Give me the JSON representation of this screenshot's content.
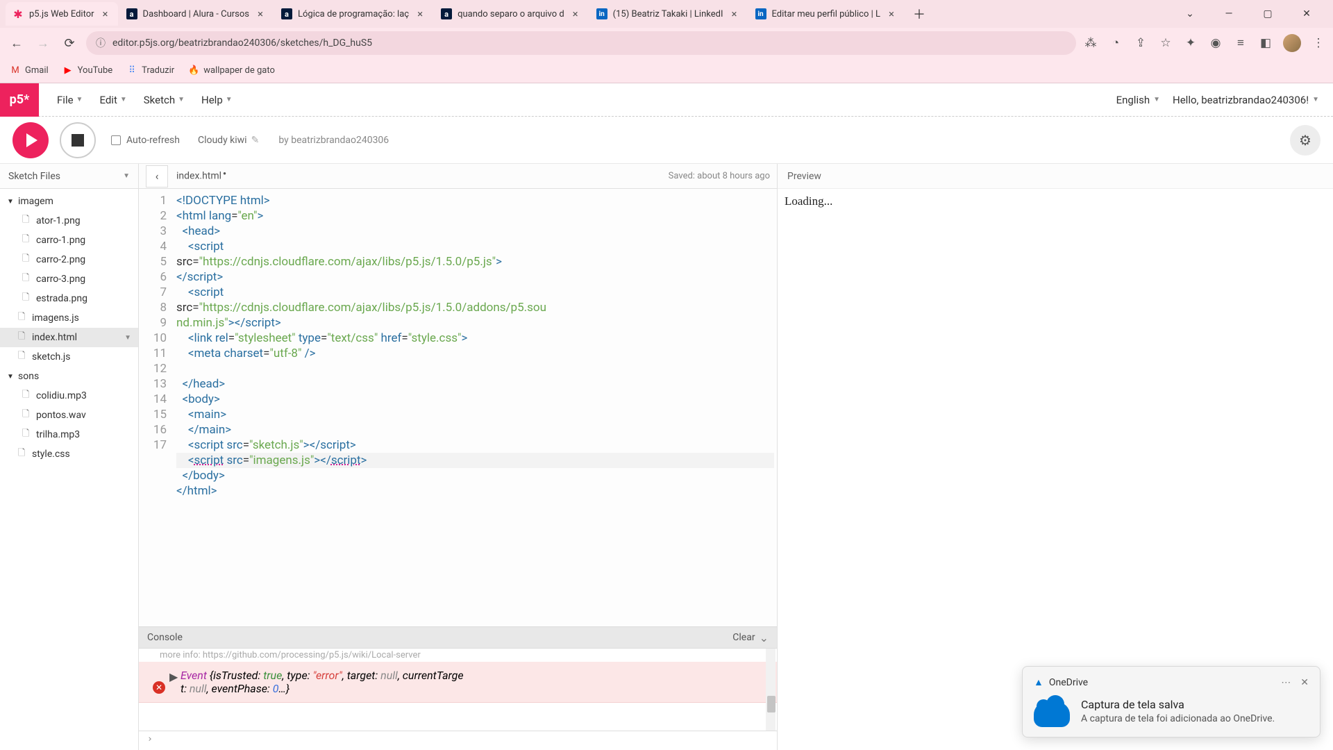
{
  "browser": {
    "tabs": [
      {
        "title": "p5.js Web Editor",
        "active": true,
        "icon": "p5"
      },
      {
        "title": "Dashboard | Alura - Cursos",
        "active": false,
        "icon": "alura"
      },
      {
        "title": "Lógica de programação: laç",
        "active": false,
        "icon": "alura"
      },
      {
        "title": "quando separo o arquivo d",
        "active": false,
        "icon": "alura"
      },
      {
        "title": "(15) Beatriz Takaki | LinkedI",
        "active": false,
        "icon": "linkedin"
      },
      {
        "title": "Editar meu perfil público | L",
        "active": false,
        "icon": "linkedin"
      }
    ],
    "url": "editor.p5js.org/beatrizbrandao240306/sketches/h_DG_huS5",
    "bookmarks": [
      {
        "label": "Gmail",
        "icon": "M",
        "color": "#d93025"
      },
      {
        "label": "YouTube",
        "icon": "▶",
        "color": "#ff0000"
      },
      {
        "label": "Traduzir",
        "icon": "⠿",
        "color": "#4285f4"
      },
      {
        "label": "wallpaper de gato",
        "icon": "🔥",
        "color": "#f57c00"
      }
    ]
  },
  "menubar": {
    "logo": "p5*",
    "items": [
      "File",
      "Edit",
      "Sketch",
      "Help"
    ],
    "language": "English",
    "hello": "Hello, beatrizbrandao240306!"
  },
  "toolbar": {
    "auto_refresh": "Auto-refresh",
    "sketch_name": "Cloudy kiwi",
    "byline": "by beatrizbrandao240306"
  },
  "sidebar": {
    "header": "Sketch Files",
    "tree": [
      {
        "name": "imagem",
        "type": "folder",
        "open": true
      },
      {
        "name": "ator-1.png",
        "type": "file",
        "nested": true
      },
      {
        "name": "carro-1.png",
        "type": "file",
        "nested": true
      },
      {
        "name": "carro-2.png",
        "type": "file",
        "nested": true
      },
      {
        "name": "carro-3.png",
        "type": "file",
        "nested": true
      },
      {
        "name": "estrada.png",
        "type": "file",
        "nested": true
      },
      {
        "name": "imagens.js",
        "type": "file"
      },
      {
        "name": "index.html",
        "type": "file",
        "selected": true
      },
      {
        "name": "sketch.js",
        "type": "file"
      },
      {
        "name": "sons",
        "type": "folder",
        "open": true
      },
      {
        "name": "colidiu.mp3",
        "type": "file",
        "nested": true
      },
      {
        "name": "pontos.wav",
        "type": "file",
        "nested": true
      },
      {
        "name": "trilha.mp3",
        "type": "file",
        "nested": true
      },
      {
        "name": "style.css",
        "type": "file"
      }
    ]
  },
  "editor": {
    "current_file": "index.html",
    "unsaved": true,
    "saved_text": "Saved: about 8 hours ago",
    "lines": [
      [
        {
          "t": "tag",
          "v": "<!DOCTYPE html>"
        }
      ],
      [
        {
          "t": "tag",
          "v": "<html "
        },
        {
          "t": "attr",
          "v": "lang"
        },
        {
          "t": "punc",
          "v": "="
        },
        {
          "t": "str",
          "v": "\"en\""
        },
        {
          "t": "tag",
          "v": ">"
        }
      ],
      [
        {
          "t": "text",
          "v": "  "
        },
        {
          "t": "tag",
          "v": "<head>"
        }
      ],
      [
        {
          "t": "text",
          "v": "    "
        },
        {
          "t": "tag",
          "v": "<script "
        },
        {
          "t": "text",
          "v": "\nsrc="
        },
        {
          "t": "str",
          "v": "\"https://cdnjs.cloudflare.com/ajax/libs/p5.js/1.5.0/p5.js\""
        },
        {
          "t": "tag",
          "v": ">"
        },
        {
          "t": "text",
          "v": "\n"
        },
        {
          "t": "tag",
          "v": "<​/script>"
        }
      ],
      [
        {
          "t": "text",
          "v": "    "
        },
        {
          "t": "tag",
          "v": "<script "
        },
        {
          "t": "text",
          "v": "\nsrc="
        },
        {
          "t": "str",
          "v": "\"https://cdnjs.cloudflare.com/ajax/libs/p5.js/1.5.0/addons/p5.sou\nnd.min.js\""
        },
        {
          "t": "tag",
          "v": ">"
        },
        {
          "t": "tag",
          "v": "<​/script>"
        }
      ],
      [
        {
          "t": "text",
          "v": "    "
        },
        {
          "t": "tag",
          "v": "<link "
        },
        {
          "t": "attr",
          "v": "rel"
        },
        {
          "t": "punc",
          "v": "="
        },
        {
          "t": "str",
          "v": "\"stylesheet\""
        },
        {
          "t": "text",
          "v": " "
        },
        {
          "t": "attr",
          "v": "type"
        },
        {
          "t": "punc",
          "v": "="
        },
        {
          "t": "str",
          "v": "\"text/css\""
        },
        {
          "t": "text",
          "v": " "
        },
        {
          "t": "attr",
          "v": "href"
        },
        {
          "t": "punc",
          "v": "="
        },
        {
          "t": "str",
          "v": "\"style.css\""
        },
        {
          "t": "tag",
          "v": ">"
        }
      ],
      [
        {
          "t": "text",
          "v": "    "
        },
        {
          "t": "tag",
          "v": "<meta "
        },
        {
          "t": "attr",
          "v": "charset"
        },
        {
          "t": "punc",
          "v": "="
        },
        {
          "t": "str",
          "v": "\"utf-8\""
        },
        {
          "t": "tag",
          "v": " />"
        }
      ],
      [],
      [
        {
          "t": "text",
          "v": "  "
        },
        {
          "t": "tag",
          "v": "</head>"
        }
      ],
      [
        {
          "t": "text",
          "v": "  "
        },
        {
          "t": "tag",
          "v": "<body>"
        }
      ],
      [
        {
          "t": "text",
          "v": "    "
        },
        {
          "t": "tag",
          "v": "<main>"
        }
      ],
      [
        {
          "t": "text",
          "v": "    "
        },
        {
          "t": "tag",
          "v": "</main>"
        }
      ],
      [
        {
          "t": "text",
          "v": "    "
        },
        {
          "t": "tag",
          "v": "<script "
        },
        {
          "t": "attr",
          "v": "src"
        },
        {
          "t": "punc",
          "v": "="
        },
        {
          "t": "str",
          "v": "\"sketch.js\""
        },
        {
          "t": "tag",
          "v": ">"
        },
        {
          "t": "tag",
          "v": "<​/script>"
        }
      ],
      [
        {
          "t": "text",
          "v": "    "
        },
        {
          "t": "tag",
          "v": "<"
        },
        {
          "t": "tag underline",
          "v": "script"
        },
        {
          "t": "text",
          "v": " "
        },
        {
          "t": "attr",
          "v": "src"
        },
        {
          "t": "punc",
          "v": "="
        },
        {
          "t": "str",
          "v": "\"imagens.js\""
        },
        {
          "t": "tag",
          "v": ">"
        },
        {
          "t": "tag",
          "v": "</"
        },
        {
          "t": "tag underline",
          "v": "script"
        },
        {
          "t": "tag",
          "v": ">"
        }
      ],
      [
        {
          "t": "text",
          "v": "  "
        },
        {
          "t": "tag",
          "v": "</body>"
        }
      ],
      [
        {
          "t": "tag",
          "v": "</html>"
        }
      ],
      []
    ],
    "gutter_numbers": [
      "1",
      "2",
      "3",
      "4",
      "",
      "",
      "5",
      "",
      "",
      "6",
      "7",
      "8",
      "9",
      "10",
      "11",
      "12",
      "13",
      "14",
      "15",
      "16",
      "17"
    ],
    "highlight_phys_line": 17
  },
  "console": {
    "header": "Console",
    "clear": "Clear",
    "truncated_hint": "    more info: https://github.com/processing/p5.js/wiki/Local-server",
    "error_tokens": [
      {
        "t": "key",
        "v": "Event "
      },
      {
        "t": "text",
        "v": "{isTrusted: "
      },
      {
        "t": "true",
        "v": "true"
      },
      {
        "t": "text",
        "v": ", type: "
      },
      {
        "t": "str",
        "v": "\"error\""
      },
      {
        "t": "text",
        "v": ", target: "
      },
      {
        "t": "null",
        "v": "null"
      },
      {
        "t": "text",
        "v": ", currentTarge\nt: "
      },
      {
        "t": "null",
        "v": "null"
      },
      {
        "t": "text",
        "v": ", eventPhase: "
      },
      {
        "t": "num",
        "v": "0"
      },
      {
        "t": "text",
        "v": "…}"
      }
    ],
    "prompt": "›"
  },
  "preview": {
    "header": "Preview",
    "body": "Loading..."
  },
  "toast": {
    "app": "OneDrive",
    "title": "Captura de tela salva",
    "message": "A captura de tela foi adicionada ao OneDrive."
  }
}
